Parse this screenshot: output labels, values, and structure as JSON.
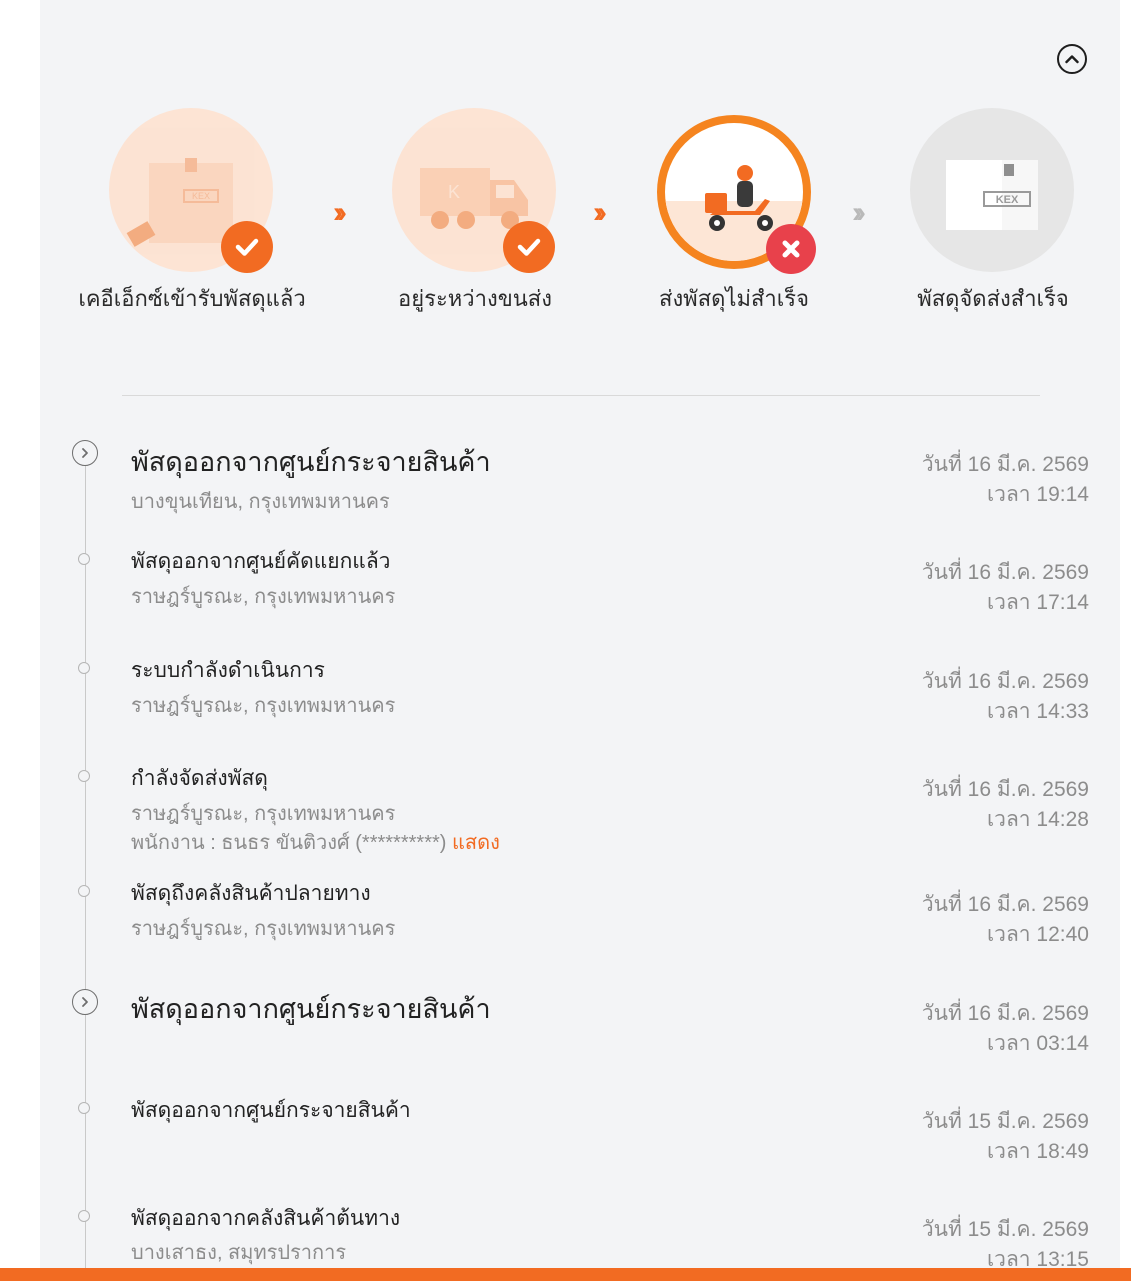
{
  "steps": [
    {
      "label": "เคอีเอ็กซ์เข้ารับพัสดุแล้ว",
      "status": "done",
      "icon": "box-handover-icon"
    },
    {
      "label": "อยู่ระหว่างขนส่ง",
      "status": "done",
      "icon": "truck-icon"
    },
    {
      "label": "ส่งพัสดุไม่สำเร็จ",
      "status": "failed",
      "icon": "delivery-scooter-icon"
    },
    {
      "label": "พัสดุจัดส่งสำเร็จ",
      "status": "pending",
      "icon": "box-icon"
    }
  ],
  "box_brand": "KEX",
  "events": [
    {
      "title": "พัสดุออกจากศูนย์กระจายสินค้า",
      "location": "บางขุนเทียน, กรุงเทพมหานคร",
      "date": "วันที่ 16 มี.ค. 2569",
      "time": "เวลา 19:14",
      "major": true
    },
    {
      "title": "พัสดุออกจากศูนย์คัดแยกแล้ว",
      "location": "ราษฎร์บูรณะ, กรุงเทพมหานคร",
      "date": "วันที่ 16 มี.ค. 2569",
      "time": "เวลา 17:14",
      "major": false
    },
    {
      "title": "ระบบกำลังดำเนินการ",
      "location": "ราษฎร์บูรณะ, กรุงเทพมหานคร",
      "date": "วันที่ 16 มี.ค. 2569",
      "time": "เวลา 14:33",
      "major": false
    },
    {
      "title": "กำลังจัดส่งพัสดุ",
      "location": "ราษฎร์บูรณะ, กรุงเทพมหานคร",
      "staff": "พนักงาน : ธนธร ขันติวงศ์ (**********)",
      "staff_action": "แสดง",
      "date": "วันที่ 16 มี.ค. 2569",
      "time": "เวลา 14:28",
      "major": false
    },
    {
      "title": "พัสดุถึงคลังสินค้าปลายทาง",
      "location": "ราษฎร์บูรณะ, กรุงเทพมหานคร",
      "date": "วันที่ 16 มี.ค. 2569",
      "time": "เวลา 12:40",
      "major": false
    },
    {
      "title": "พัสดุออกจากศูนย์กระจายสินค้า",
      "location": "",
      "date": "วันที่ 16 มี.ค. 2569",
      "time": "เวลา 03:14",
      "major": true
    },
    {
      "title": "พัสดุออกจากศูนย์กระจายสินค้า",
      "location": "",
      "date": "วันที่ 15 มี.ค. 2569",
      "time": "เวลา 18:49",
      "major": false
    },
    {
      "title": "พัสดุออกจากคลังสินค้าต้นทาง",
      "location": "บางเสาธง, สมุทรปราการ",
      "date": "วันที่ 15 มี.ค. 2569",
      "time": "เวลา 13:15",
      "major": false
    }
  ],
  "colors": {
    "accent": "#f26b22",
    "fail": "#e8414b",
    "muted": "#8c8c8c"
  }
}
